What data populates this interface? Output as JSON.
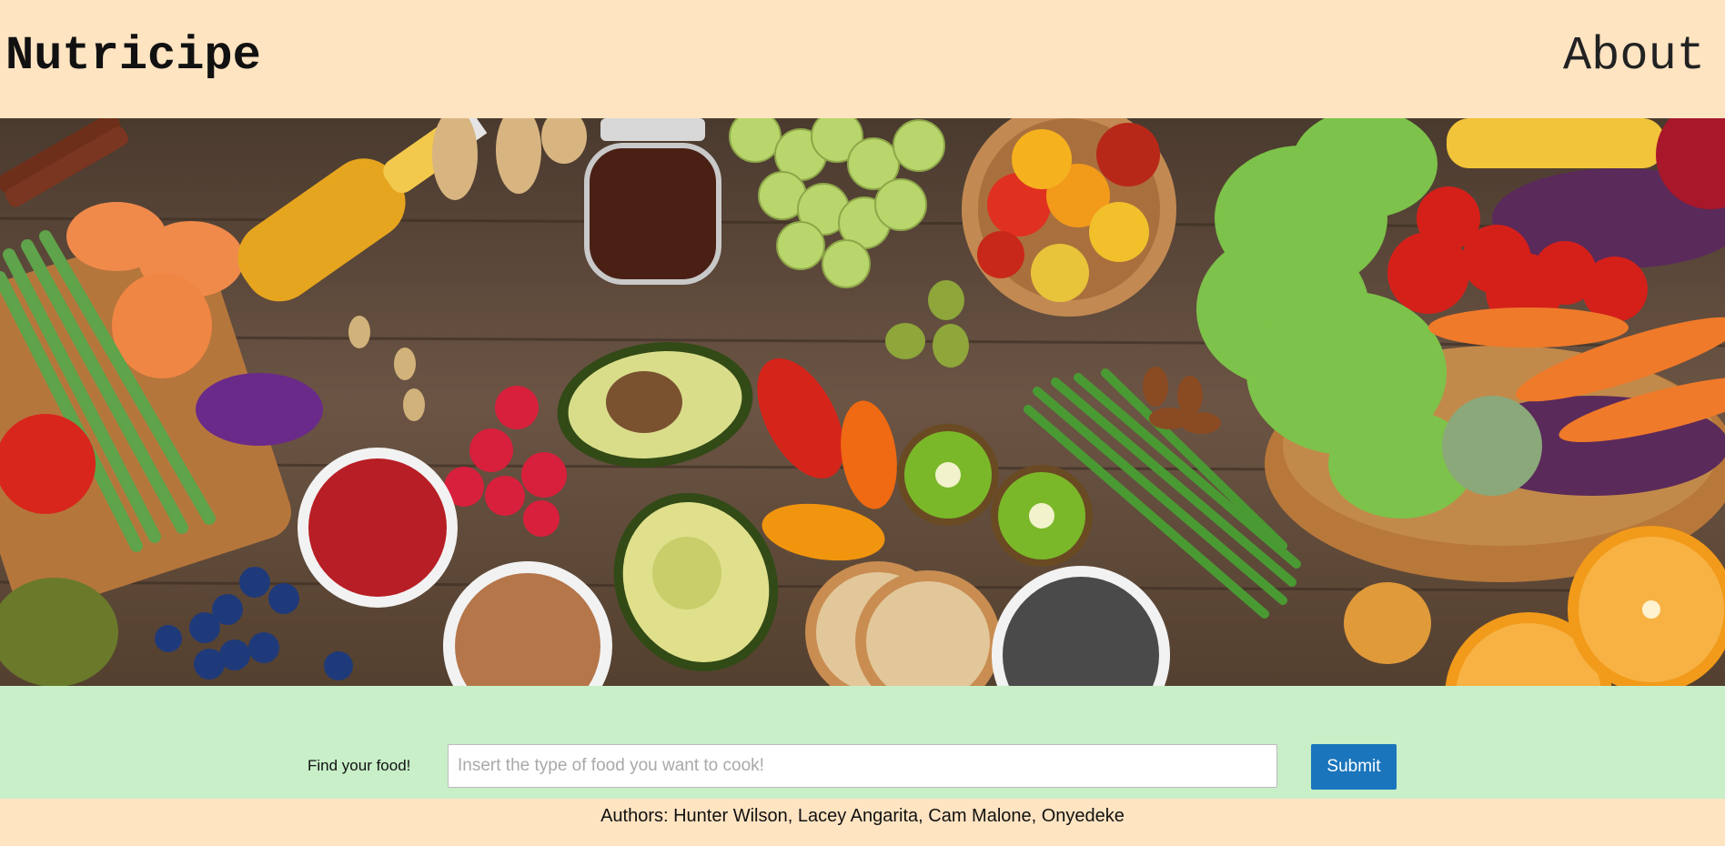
{
  "header": {
    "brand": "Nutricipe",
    "about_link": "About"
  },
  "hero": {
    "image_icon": "food-banner-image"
  },
  "search": {
    "label": "Find your food!",
    "placeholder": "Insert the type of food you want to cook!",
    "value": "",
    "submit_label": "Submit",
    "submit_color": "#1a75bc"
  },
  "footer": {
    "authors": "Authors: Hunter Wilson, Lacey Angarita, Cam Malone, Onyedeke"
  },
  "colors": {
    "page_bg": "#ffe4c2",
    "search_band_bg": "#c8efc8"
  }
}
